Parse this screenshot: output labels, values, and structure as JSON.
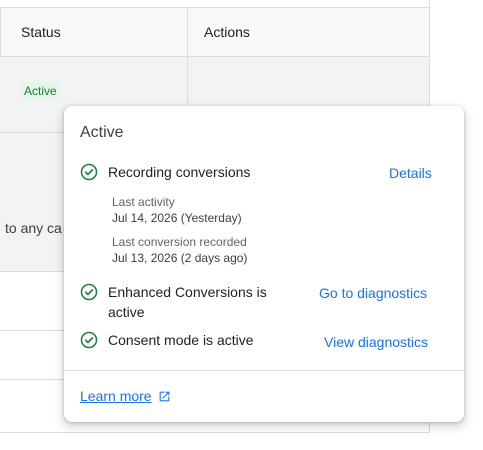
{
  "table": {
    "headers": {
      "status": "Status",
      "actions": "Actions"
    },
    "row_status_chip": "Active",
    "partial_text": "to any ca"
  },
  "popover": {
    "title": "Active",
    "items": [
      {
        "label": "Recording conversions",
        "link": "Details",
        "meta": [
          {
            "label": "Last activity",
            "value": "Jul 14, 2026 (Yesterday)"
          },
          {
            "label": "Last conversion recorded",
            "value": "Jul 13, 2026 (2 days ago)"
          }
        ]
      },
      {
        "label_line1": "Enhanced Conversions is",
        "label_line2": "active",
        "link": "Go to diagnostics"
      },
      {
        "label": "Consent mode is active",
        "link": "View diagnostics"
      }
    ],
    "footer_link": "Learn more",
    "icons": {
      "status": "check-circle-icon",
      "external": "external-link-icon"
    }
  },
  "colors": {
    "success": "#188038",
    "link": "#1a73e8",
    "chip_bg": "#e6f4ea"
  }
}
